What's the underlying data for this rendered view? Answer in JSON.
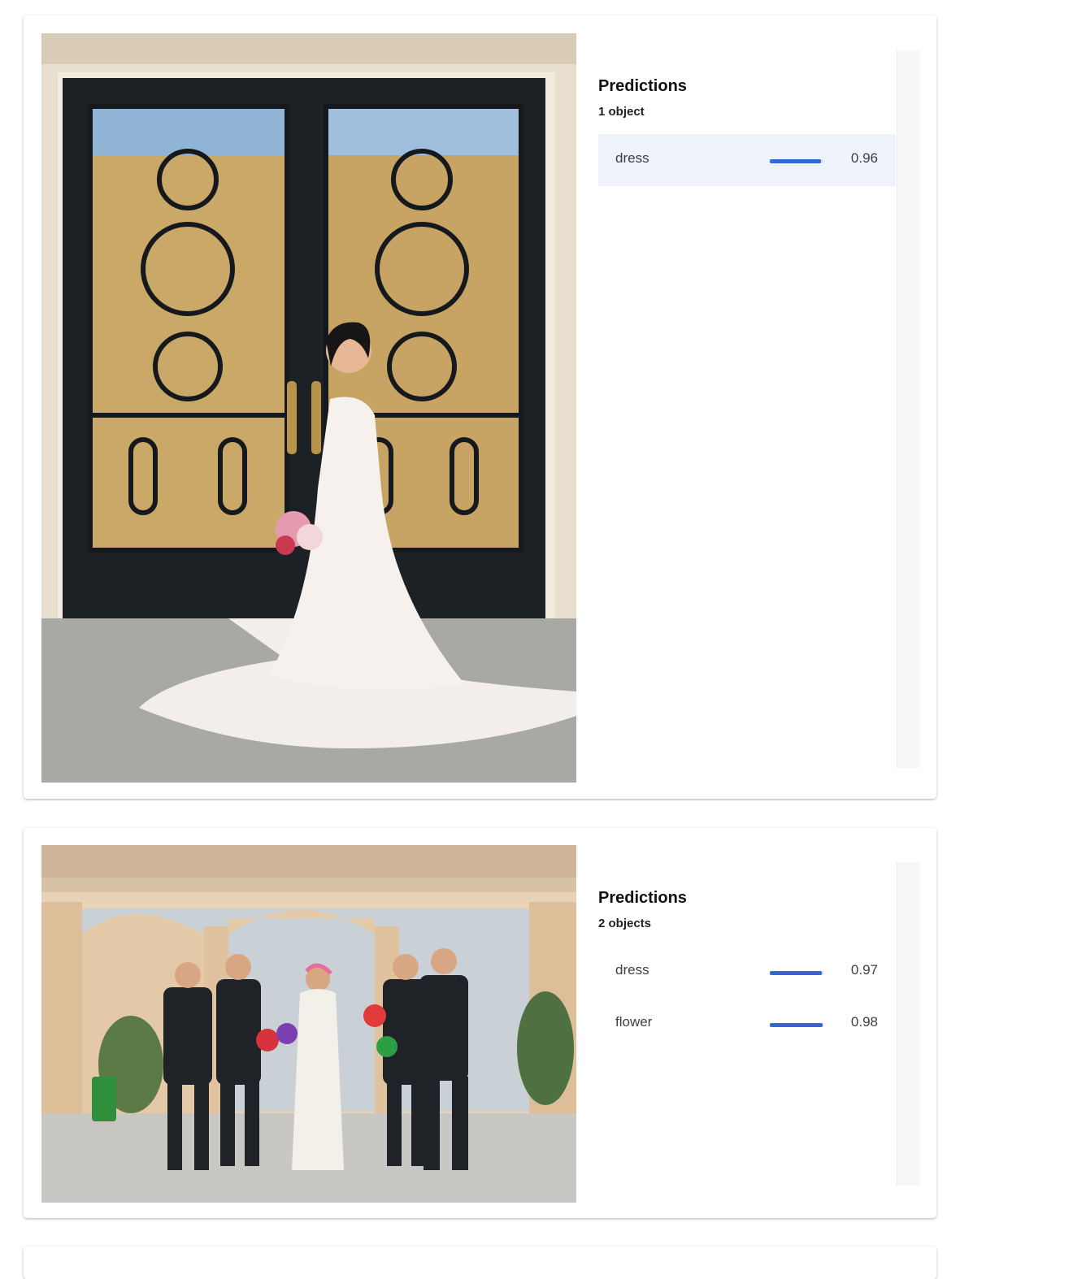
{
  "results": [
    {
      "image": "wedding-bride-at-door",
      "predictions_title": "Predictions",
      "count_label": "1 object",
      "predictions": [
        {
          "label": "dress",
          "score": "0.96",
          "fraction": 0.96,
          "selected": true
        }
      ]
    },
    {
      "image": "wedding-party-courtyard",
      "predictions_title": "Predictions",
      "count_label": "2 objects",
      "predictions": [
        {
          "label": "dress",
          "score": "0.97",
          "fraction": 0.97,
          "selected": false
        },
        {
          "label": "flower",
          "score": "0.98",
          "fraction": 0.98,
          "selected": false
        }
      ]
    }
  ],
  "colors": {
    "bar": "#3367d6",
    "selected_row": "#edf2fb"
  }
}
